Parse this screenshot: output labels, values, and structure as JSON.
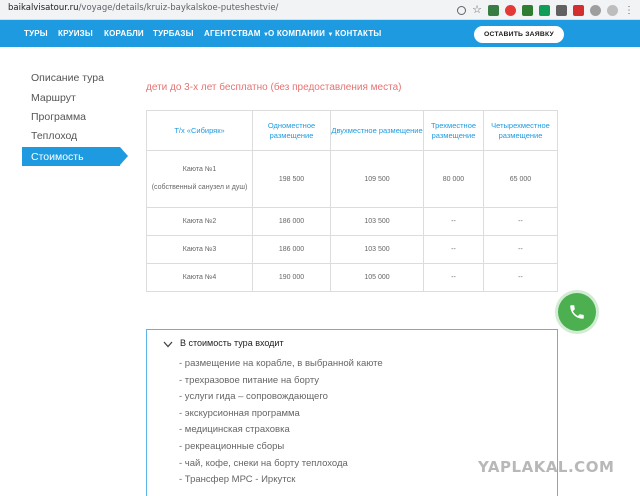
{
  "browser": {
    "url_host": "baikalvisatour.ru",
    "url_path": "/voyage/details/kruiz-baykalskoe-puteshestvie/"
  },
  "nav": {
    "items": [
      "ТУРЫ",
      "КРУИЗЫ",
      "КОРАБЛИ",
      "ТУРБАЗЫ",
      "АГЕНТСТВАМ",
      "О КОМПАНИИ",
      "КОНТАКТЫ"
    ],
    "cta_label": "ОСТАВИТЬ ЗАЯВКУ",
    "accent": "#1e9be0"
  },
  "sidebar": {
    "items": [
      "Описание тура",
      "Маршрут",
      "Программа",
      "Теплоход",
      "Стоимость"
    ],
    "active": "Стоимость"
  },
  "note": "дети до 3-х лет бесплатно (без предоставления места)",
  "table": {
    "headers": [
      "Т/х «Сибиряк»",
      "Одноместное размещение",
      "Двухместное размещение",
      "Трехместное размещение",
      "Четырехместное размещение"
    ],
    "rows": [
      {
        "cabin": "Каюта №1",
        "cabin_note": "(собственный санузел и душ)",
        "cells": [
          "198 500",
          "109 500",
          "80 000",
          "65 000"
        ]
      },
      {
        "cabin": "Каюта №2",
        "cabin_note": "",
        "cells": [
          "186 000",
          "103 500",
          "--",
          "--"
        ]
      },
      {
        "cabin": "Каюта №3",
        "cabin_note": "",
        "cells": [
          "186 000",
          "103 500",
          "--",
          "--"
        ]
      },
      {
        "cabin": "Каюта №4",
        "cabin_note": "",
        "cells": [
          "190 000",
          "105 000",
          "--",
          "--"
        ]
      }
    ]
  },
  "included": {
    "title": "В стоимость тура входит",
    "items": [
      "- размещение на корабле, в выбранной каюте",
      "- трехразовое питание на борту",
      "- услуги гида – сопровождающего",
      "- экскурсионная программа",
      "- медицинская страховка",
      "- рекреационные сборы",
      "- чай, кофе, снеки на борту теплохода",
      "- Трансфер МРС - Иркутск"
    ]
  },
  "watermark": "YAPLAKAL.COM"
}
